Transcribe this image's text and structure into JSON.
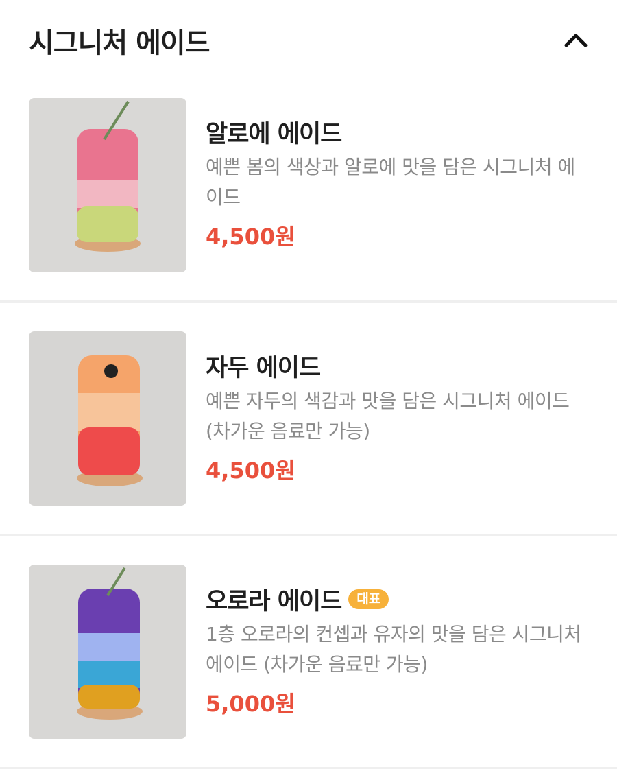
{
  "section": {
    "title": "시그니처 에이드",
    "toggle_icon": "chevron-up-icon"
  },
  "items": [
    {
      "name": "알로에 에이드",
      "description": "예쁜 봄의 색상과 알로에 맛을 담은 시그니처 에이드",
      "price": "4,500원",
      "badge": "",
      "colors": [
        "#e9748f",
        "#f2b7c2",
        "#c9d77a"
      ]
    },
    {
      "name": "자두 에이드",
      "description": "예쁜 자두의 색감과 맛을 담은 시그니처 에이드 (차가운 음료만 가능)",
      "price": "4,500원",
      "badge": "",
      "colors": [
        "#f5a46a",
        "#f7c49a",
        "#ee4b4b"
      ]
    },
    {
      "name": "오로라 에이드",
      "description": "1층 오로라의 컨셉과 유자의 맛을 담은 시그니처 에이드 (차가운 음료만 가능)",
      "price": "5,000원",
      "badge": "대표",
      "colors": [
        "#6a3fb0",
        "#9fb3f0",
        "#3aa6d6",
        "#e0a020"
      ]
    }
  ],
  "accent_colors": {
    "price": "#e9503c",
    "badge": "#f7b13a"
  }
}
